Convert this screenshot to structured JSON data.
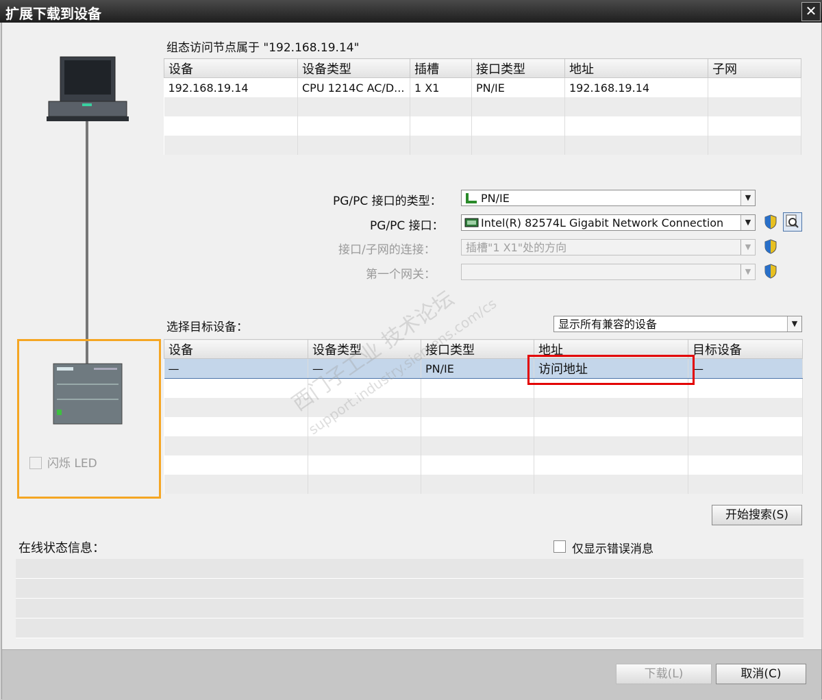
{
  "window": {
    "title": "扩展下载到设备",
    "close_glyph": "✕"
  },
  "config_caption": "组态访问节点属于 \"192.168.19.14\"",
  "top_table": {
    "headers": [
      "设备",
      "设备类型",
      "插槽",
      "接口类型",
      "地址",
      "子网"
    ],
    "row": [
      "192.168.19.14",
      "CPU 1214C AC/D...",
      "1 X1",
      "PN/IE",
      "192.168.19.14",
      ""
    ]
  },
  "pgpc": {
    "type_label": "PG/PC 接口的类型：",
    "type_value": "PN/IE",
    "interface_label": "PG/PC 接口：",
    "interface_value": "Intel(R) 82574L Gigabit Network Connection",
    "subnet_label": "接口/子网的连接：",
    "subnet_value": "插槽\"1 X1\"处的方向",
    "gateway_label": "第一个网关：",
    "gateway_value": ""
  },
  "target": {
    "label": "选择目标设备：",
    "filter_value": "显示所有兼容的设备",
    "headers": [
      "设备",
      "设备类型",
      "接口类型",
      "地址",
      "目标设备"
    ],
    "row": [
      "—",
      "—",
      "PN/IE",
      "访问地址",
      "—"
    ]
  },
  "flash_led_label": "闪烁 LED",
  "search_button": "开始搜索(S)",
  "status": {
    "label": "在线状态信息：",
    "errors_only_label": "仅显示错误消息"
  },
  "footer": {
    "download_button": "下载(L)",
    "cancel_button": "取消(C)"
  },
  "watermark": {
    "line1": "西门子工业  技术论坛",
    "line2": "support.industry.siemens.com/cs"
  },
  "colors": {
    "highlight_box": "#e30000",
    "device_frame": "#f5a623",
    "selection_row": "#c4d6ea"
  }
}
